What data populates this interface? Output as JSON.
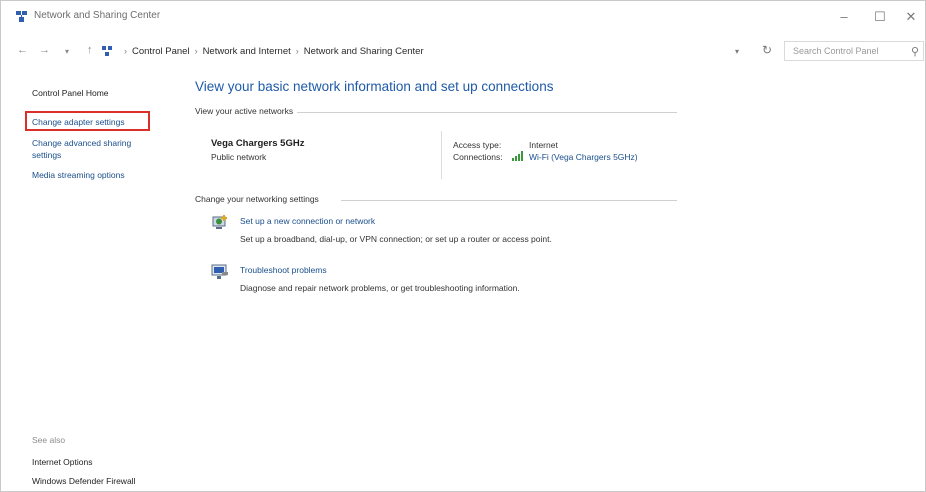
{
  "window": {
    "title": "Network and Sharing Center",
    "controls": {
      "minimize": "–",
      "maximize": "☐",
      "close": "✕"
    }
  },
  "address": {
    "crumbs": [
      "Control Panel",
      "Network and Internet",
      "Network and Sharing Center"
    ],
    "search_placeholder": "Search Control Panel"
  },
  "sidebar": {
    "home": "Control Panel Home",
    "items": [
      {
        "label": "Change adapter settings",
        "highlighted": true
      },
      {
        "label_line1": "Change advanced sharing",
        "label_line2": "settings"
      },
      {
        "label": "Media streaming options"
      }
    ],
    "see_also_heading": "See also",
    "see_also": [
      "Internet Options",
      "Windows Defender Firewall"
    ]
  },
  "main": {
    "title": "View your basic network information and set up connections",
    "active_heading": "View your active networks",
    "network": {
      "name": "Vega Chargers 5GHz",
      "type": "Public network",
      "access_type_label": "Access type:",
      "access_type_value": "Internet",
      "connections_label": "Connections:",
      "connections_value": "Wi-Fi (Vega Chargers 5GHz)"
    },
    "settings_heading": "Change your networking settings",
    "tasks": [
      {
        "link": "Set up a new connection or network",
        "desc": "Set up a broadband, dial-up, or VPN connection; or set up a router or access point.",
        "icon": "new-connection-icon"
      },
      {
        "link": "Troubleshoot problems",
        "desc": "Diagnose and repair network problems, or get troubleshooting information.",
        "icon": "troubleshoot-icon"
      }
    ]
  },
  "colors": {
    "link": "#1a4f8c",
    "title": "#1e5aa8",
    "highlight": "#d9302a"
  }
}
